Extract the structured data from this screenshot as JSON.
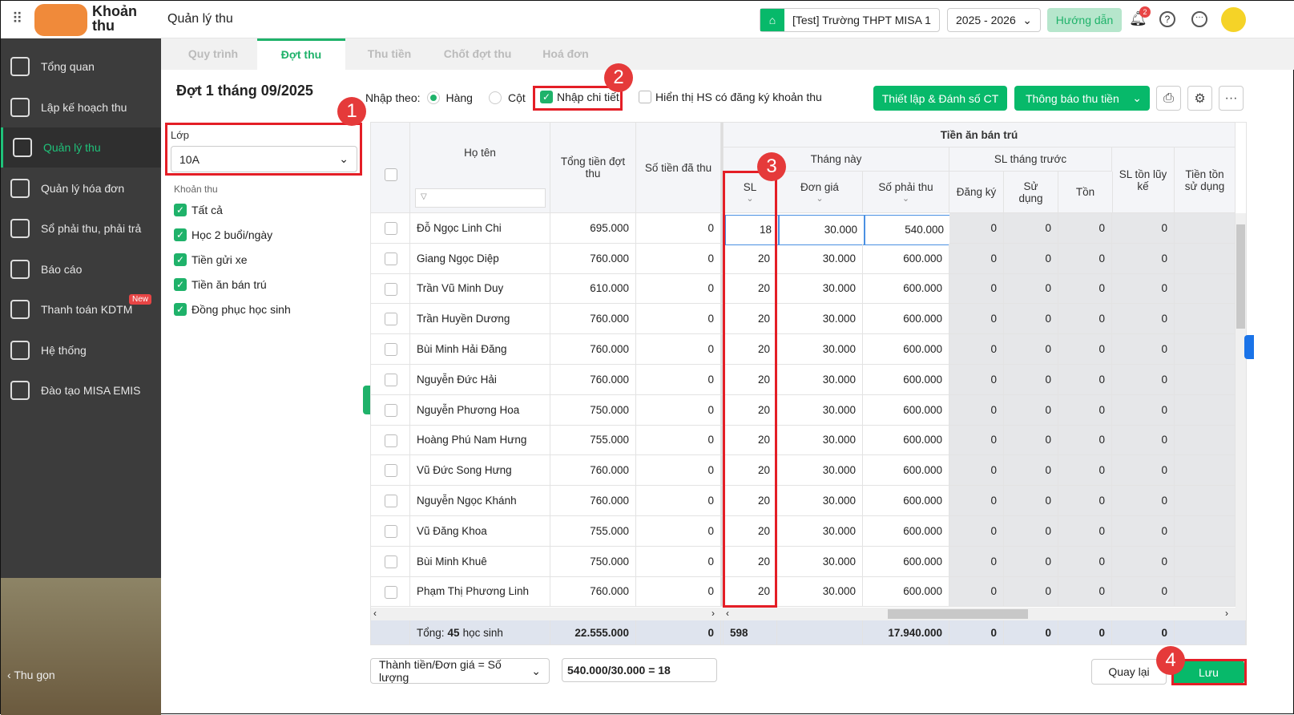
{
  "app": {
    "name_line1": "Khoản",
    "name_line2": "thu",
    "page_title": "Quản lý thu",
    "school": "[Test] Trường THPT MISA 1",
    "year": "2025 - 2026",
    "guide_button": "Hướng dẫn",
    "notifications": "2"
  },
  "sidebar": {
    "items": [
      {
        "label": "Tổng quan",
        "icon": "chart-icon"
      },
      {
        "label": "Lập kế hoạch thu",
        "icon": "calendar-icon"
      },
      {
        "label": "Quản lý thu",
        "icon": "money-hand-icon",
        "active": true
      },
      {
        "label": "Quản lý hóa đơn",
        "icon": "document-icon"
      },
      {
        "label": "Sổ phải thu, phải trả",
        "icon": "book-icon"
      },
      {
        "label": "Báo cáo",
        "icon": "pie-chart-icon"
      },
      {
        "label": "Thanh toán KDTM",
        "icon": "card-icon",
        "badge": "New"
      },
      {
        "label": "Hệ thống",
        "icon": "gear-icon"
      },
      {
        "label": "Đào tạo MISA EMIS",
        "icon": "open-book-icon"
      }
    ],
    "collapse": "Thu gọn"
  },
  "tabs": [
    {
      "label": "Quy trình"
    },
    {
      "label": "Đợt thu",
      "active": true
    },
    {
      "label": "Thu tiền"
    },
    {
      "label": "Chốt đợt thu"
    },
    {
      "label": "Hoá đơn"
    }
  ],
  "batch_title": "Đợt 1 tháng 09/2025",
  "filter": {
    "class_label": "Lớp",
    "class_value": "10A",
    "fees_label": "Khoản thu",
    "fees": [
      "Tất cả",
      "Học 2 buổi/ngày",
      "Tiền gửi xe",
      "Tiền ăn bán trú",
      "Đồng phục học sinh"
    ]
  },
  "toolbar": {
    "input_by": "Nhập theo:",
    "row": "Hàng",
    "col": "Cột",
    "detail": "Nhập chi tiết",
    "show_registered": "Hiển thị HS có đăng ký khoản thu",
    "setup_button": "Thiết lập & Đánh số CT",
    "notify_button": "Thông báo thu tiền"
  },
  "table": {
    "headers": {
      "name": "Họ tên",
      "total": "Tổng tiền đợt thu",
      "paid": "Số tiền đã thu",
      "group": "Tiền ăn bán trú",
      "this_month": "Tháng này",
      "sl": "SL",
      "price": "Đơn giá",
      "due": "Số phải thu",
      "last_month": "SL tháng trước",
      "registered": "Đăng ký",
      "used": "Sử dụng",
      "remain": "Tồn",
      "cum": "SL tồn lũy kế",
      "remain_money": "Tiền tồn sử dụng"
    },
    "rows": [
      [
        "Đỗ Ngọc Linh Chi",
        "695.000",
        "0",
        "18",
        "30.000",
        "540.000",
        "0",
        "0",
        "0",
        "0"
      ],
      [
        "Giang Ngọc Diệp",
        "760.000",
        "0",
        "20",
        "30.000",
        "600.000",
        "0",
        "0",
        "0",
        "0"
      ],
      [
        "Trần Vũ Minh Duy",
        "610.000",
        "0",
        "20",
        "30.000",
        "600.000",
        "0",
        "0",
        "0",
        "0"
      ],
      [
        "Trần Huyền Dương",
        "760.000",
        "0",
        "20",
        "30.000",
        "600.000",
        "0",
        "0",
        "0",
        "0"
      ],
      [
        "Bùi Minh Hải Đăng",
        "760.000",
        "0",
        "20",
        "30.000",
        "600.000",
        "0",
        "0",
        "0",
        "0"
      ],
      [
        "Nguyễn Đức Hải",
        "760.000",
        "0",
        "20",
        "30.000",
        "600.000",
        "0",
        "0",
        "0",
        "0"
      ],
      [
        "Nguyễn Phương Hoa",
        "750.000",
        "0",
        "20",
        "30.000",
        "600.000",
        "0",
        "0",
        "0",
        "0"
      ],
      [
        "Hoàng Phú Nam Hưng",
        "755.000",
        "0",
        "20",
        "30.000",
        "600.000",
        "0",
        "0",
        "0",
        "0"
      ],
      [
        "Vũ Đức Song Hưng",
        "760.000",
        "0",
        "20",
        "30.000",
        "600.000",
        "0",
        "0",
        "0",
        "0"
      ],
      [
        "Nguyễn Ngọc Khánh",
        "760.000",
        "0",
        "20",
        "30.000",
        "600.000",
        "0",
        "0",
        "0",
        "0"
      ],
      [
        "Vũ Đăng Khoa",
        "755.000",
        "0",
        "20",
        "30.000",
        "600.000",
        "0",
        "0",
        "0",
        "0"
      ],
      [
        "Bùi Minh Khuê",
        "750.000",
        "0",
        "20",
        "30.000",
        "600.000",
        "0",
        "0",
        "0",
        "0"
      ],
      [
        "Phạm Thị Phương Linh",
        "760.000",
        "0",
        "20",
        "30.000",
        "600.000",
        "0",
        "0",
        "0",
        "0"
      ]
    ],
    "totals": {
      "label": "Tổng:",
      "count": "45",
      "unit": "học sinh",
      "total": "22.555.000",
      "paid": "0",
      "sl": "598",
      "due": "17.940.000",
      "registered": "0",
      "used": "0",
      "remain": "0",
      "cum": "0"
    }
  },
  "footer": {
    "formula_select": "Thành tiền/Đơn giá = Số lượng",
    "formula_result": "540.000/30.000 = 18",
    "back": "Quay lại",
    "save": "Lưu"
  },
  "annotations": [
    "1",
    "2",
    "3",
    "4"
  ],
  "colors": {
    "accent": "#07b96a",
    "annotation": "#e41e26"
  }
}
